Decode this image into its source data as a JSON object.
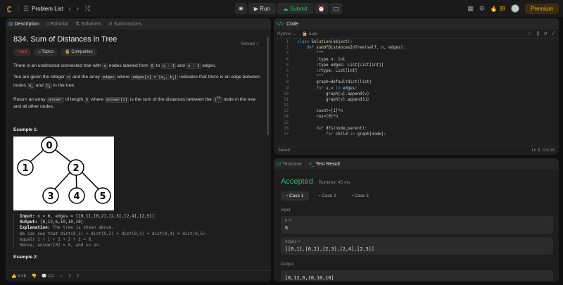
{
  "topbar": {
    "title": "Problem List",
    "run_label": "Run",
    "submit_label": "Submit",
    "streak": "39",
    "premium_label": "Premium"
  },
  "description": {
    "tabs": [
      "Description",
      "Editorial",
      "Solutions",
      "Submissions"
    ],
    "title": "834. Sum of Distances in Tree",
    "solved_label": "Solved",
    "difficulty": "Hard",
    "topics_label": "Topics",
    "companies_label": "Companies",
    "p1": {
      "a": "There is an undirected connected tree with ",
      "n": "n",
      "b": " nodes labeled from ",
      "zero": "0",
      "c": " to ",
      "nm1": "n - 1",
      "d": " and ",
      "nm1b": "n - 1",
      "e": " edges."
    },
    "p2": {
      "a": "You are given the integer ",
      "n": "n",
      "b": " and the array ",
      "edges": "edges",
      "c": " where ",
      "ei": "edges[i] = [a",
      "ei_sub1": "i",
      "ei_mid": ", b",
      "ei_sub2": "i",
      "ei_end": "]",
      "d": " indicates that there is an edge between nodes ",
      "ai": "a",
      "ai_sub": "i",
      "e": " and ",
      "bi": "b",
      "bi_sub": "i",
      "f": " in the tree."
    },
    "p3": {
      "a": "Return an array ",
      "answer": "answer",
      "b": " of length ",
      "n": "n",
      "c": " where ",
      "ansi": "answer[i]",
      "d": " is the sum of the distances between the ",
      "ith": "i",
      "th": "th",
      "e": " node in the tree and all other nodes."
    },
    "example1_heading": "Example 1:",
    "tree_nodes": [
      "0",
      "1",
      "2",
      "3",
      "4",
      "5"
    ],
    "ex1": {
      "input_label": "Input:",
      "input_val": " n = 6, edges = [[0,1],[0,2],[2,3],[2,4],[2,5]]",
      "output_label": "Output:",
      "output_val": " [8,12,6,10,10,10]",
      "expl_label": "Explanation:",
      "expl_val": " The tree is shown above.",
      "l4": "We can see that dist(0,1) + dist(0,2) + dist(0,3) + dist(0,4) + dist(0,5)",
      "l5": "equals 1 + 1 + 2 + 2 + 2 = 8.",
      "l6": "Hence, answer[0] = 8, and so on."
    },
    "example2_heading": "Example 2:",
    "footer": {
      "likes": "5.3K",
      "comments": "111"
    }
  },
  "code": {
    "tab_label": "Code",
    "language": "Python",
    "mode": "Auto",
    "status": "Saved",
    "cursor": "Ln 8, Col 24",
    "lines": [
      [
        {
          "t": "class ",
          "c": "kw"
        },
        {
          "t": "Solution",
          "c": "fn"
        },
        {
          "t": "(object):",
          "c": ""
        }
      ],
      [
        {
          "t": "    ",
          "c": ""
        },
        {
          "t": "def ",
          "c": "kw"
        },
        {
          "t": "sumOfDistancesInTree",
          "c": "fn"
        },
        {
          "t": "(self, n, edges):",
          "c": ""
        }
      ],
      [
        {
          "t": "        \"\"\"",
          "c": ""
        }
      ],
      [
        {
          "t": "        :type n: int",
          "c": ""
        }
      ],
      [
        {
          "t": "        :type edges: List[List[int]]",
          "c": ""
        }
      ],
      [
        {
          "t": "        :rtype: List[int]",
          "c": ""
        }
      ],
      [
        {
          "t": "        \"\"\"",
          "c": ""
        }
      ],
      [
        {
          "t": "        graph=defaultdict(list)",
          "c": ""
        }
      ],
      [
        {
          "t": "        ",
          "c": ""
        },
        {
          "t": "for ",
          "c": "kw"
        },
        {
          "t": "u,v ",
          "c": ""
        },
        {
          "t": "in ",
          "c": "kw"
        },
        {
          "t": "edges:",
          "c": "st"
        }
      ],
      [
        {
          "t": "            graph[u].append(v)",
          "c": ""
        }
      ],
      [
        {
          "t": "            graph[v].append(u)",
          "c": ""
        }
      ],
      [
        {
          "t": "",
          "c": ""
        }
      ],
      [
        {
          "t": "        count=[1]*n",
          "c": ""
        }
      ],
      [
        {
          "t": "        res=[0]*n",
          "c": ""
        }
      ],
      [
        {
          "t": "",
          "c": ""
        }
      ],
      [
        {
          "t": "        ",
          "c": ""
        },
        {
          "t": "def ",
          "c": "kw"
        },
        {
          "t": "dfs",
          "c": "fn"
        },
        {
          "t": "(node,parent):",
          "c": ""
        }
      ],
      [
        {
          "t": "            ",
          "c": ""
        },
        {
          "t": "for ",
          "c": "kw"
        },
        {
          "t": "child ",
          "c": ""
        },
        {
          "t": "in ",
          "c": "kw"
        },
        {
          "t": "graph[node]:",
          "c": ""
        }
      ]
    ]
  },
  "result": {
    "tabs": [
      "Testcase",
      "Test Result"
    ],
    "status": "Accepted",
    "runtime": "Runtime: 45 ms",
    "cases": [
      "Case 1",
      "Case 2",
      "Case 3"
    ],
    "input_label": "Input",
    "n_label": "n =",
    "n_value": "6",
    "edges_label": "edges =",
    "edges_value": "[[0,1],[0,2],[2,3],[2,4],[2,5]]",
    "output_label": "Output",
    "output_value": "[8,12,6,10,10,10]"
  }
}
